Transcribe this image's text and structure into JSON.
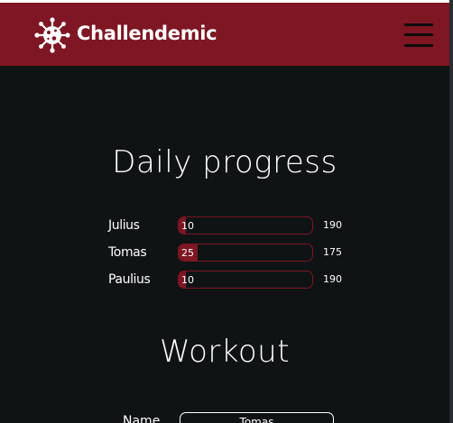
{
  "header": {
    "brand": "Challendemic",
    "logo_icon": "virus-icon",
    "menu_icon": "hamburger-menu-icon"
  },
  "colors": {
    "brand": "#7e1623",
    "background": "#0f1314",
    "text": "#ffffff"
  },
  "progress": {
    "title": "Daily progress",
    "rows": [
      {
        "name": "Julius",
        "current": "10",
        "goal": "190",
        "fraction": 0.053
      },
      {
        "name": "Tomas",
        "current": "25",
        "goal": "175",
        "fraction": 0.143
      },
      {
        "name": "Paulius",
        "current": "10",
        "goal": "190",
        "fraction": 0.053
      }
    ]
  },
  "workout": {
    "title": "Workout",
    "name_label": "Name",
    "name_value": "Tomas"
  }
}
